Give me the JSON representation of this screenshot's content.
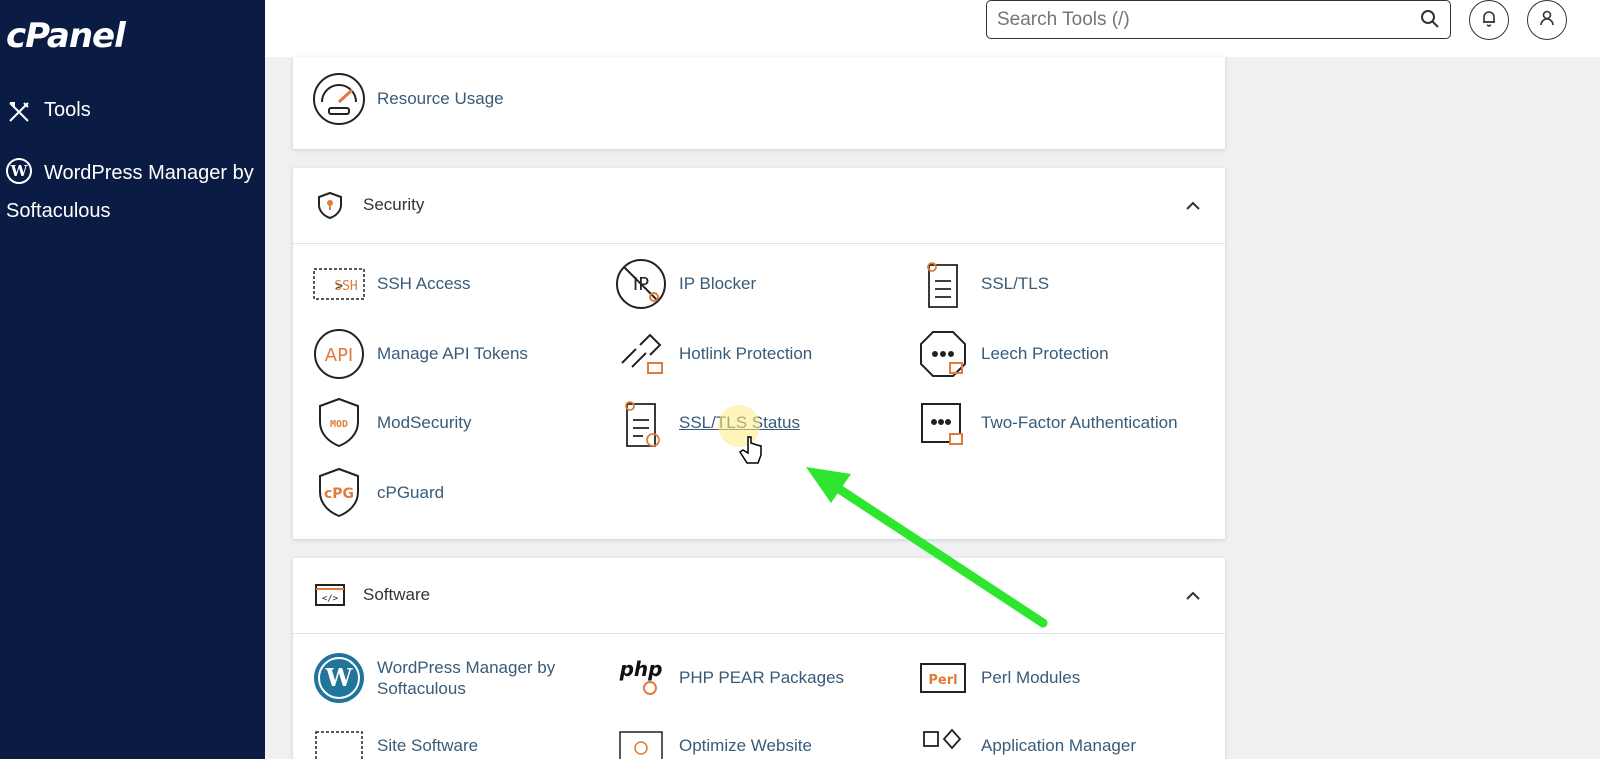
{
  "app": {
    "logo": "cPanel"
  },
  "sidebar": {
    "items": [
      {
        "label": "Tools",
        "icon": "tools-icon"
      },
      {
        "label": "WordPress Manager by Softaculous",
        "icon": "wordpress-icon"
      }
    ]
  },
  "header": {
    "search_placeholder": "Search Tools (/)",
    "icons": [
      "search-icon",
      "bell-icon",
      "user-icon"
    ]
  },
  "sections": {
    "metrics_partial": {
      "items": [
        {
          "label": "Resource Usage",
          "icon": "gauge-icon"
        }
      ]
    },
    "security": {
      "title": "Security",
      "icon": "shield-icon",
      "items": [
        {
          "label": "SSH Access",
          "icon": "ssh-terminal-icon"
        },
        {
          "label": "IP Blocker",
          "icon": "ip-blocker-icon"
        },
        {
          "label": "SSL/TLS",
          "icon": "certificate-icon"
        },
        {
          "label": "Manage API Tokens",
          "icon": "api-icon"
        },
        {
          "label": "Hotlink Protection",
          "icon": "chain-lock-icon"
        },
        {
          "label": "Leech Protection",
          "icon": "octagon-lock-icon"
        },
        {
          "label": "ModSecurity",
          "icon": "mod-shield-icon"
        },
        {
          "label": "SSL/TLS Status",
          "icon": "certificate-status-icon"
        },
        {
          "label": "Two-Factor Authentication",
          "icon": "two-factor-lock-icon"
        },
        {
          "label": "cPGuard",
          "icon": "cpguard-shield-icon"
        }
      ]
    },
    "software": {
      "title": "Software",
      "icon": "code-window-icon",
      "items": [
        {
          "label": "WordPress Manager by Softaculous",
          "icon": "wordpress-icon"
        },
        {
          "label": "PHP PEAR Packages",
          "icon": "php-icon"
        },
        {
          "label": "Perl Modules",
          "icon": "perl-icon"
        },
        {
          "label": "Site Software",
          "icon": "site-software-icon"
        },
        {
          "label": "Optimize Website",
          "icon": "optimize-icon"
        },
        {
          "label": "Application Manager",
          "icon": "app-manager-icon"
        }
      ]
    }
  },
  "colors": {
    "sidebar_bg": "#0a1c43",
    "link": "#385b79",
    "accent_orange": "#e07b39",
    "annotation_arrow": "#2ee62e"
  }
}
